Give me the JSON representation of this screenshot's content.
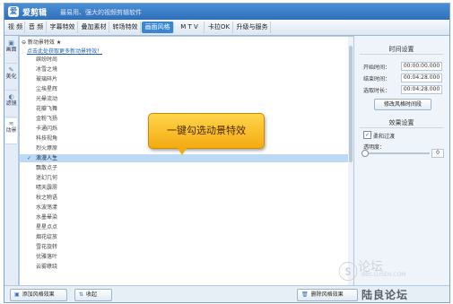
{
  "app": {
    "name": "爱剪辑",
    "slogan": "最易用、强大的视频剪辑软件",
    "logo_glyph": "爱"
  },
  "tabs": [
    {
      "label": "视 频",
      "active": false
    },
    {
      "label": "音 频",
      "active": false
    },
    {
      "label": "字幕特效",
      "active": false
    },
    {
      "label": "叠加素材",
      "active": false
    },
    {
      "label": "转场特效",
      "active": false
    },
    {
      "label": "画面风格",
      "active": true
    },
    {
      "label": "M T V",
      "active": false
    },
    {
      "label": "卡拉OK",
      "active": false
    },
    {
      "label": "升级与服务",
      "active": false
    }
  ],
  "side_tabs": [
    {
      "label": "画面",
      "icon": "▣"
    },
    {
      "label": "美化",
      "icon": "✎"
    },
    {
      "label": "滤镜",
      "icon": "◐"
    },
    {
      "label": "动景",
      "icon": "≋"
    }
  ],
  "list": {
    "header": "⊖ 新动景特效 ★",
    "link": "点击此处获取更多新动景特效！",
    "items": [
      "缤纷时尚",
      "冰雪之境",
      "玻璃碎片",
      "尘埃星辉",
      "光晕流动",
      "花瓣飞舞",
      "金粉飞扬",
      "卡通闪烁",
      "科技视角",
      "烈火燎原",
      "浪漫人生",
      "飘散点子",
      "迷幻几何",
      "晴天霹雳",
      "秋之物语",
      "水波荡漾",
      "水墨晕染",
      "星星点点",
      "烟花绽放",
      "雪花旋转",
      "优雅落叶",
      "云雾缭绕"
    ],
    "selected_index": 10
  },
  "callout": "一键勾选动景特效",
  "right_panel": {
    "time_title": "时间设置",
    "start_label": "开始时间：",
    "start_value": "00:00:00.000",
    "end_label": "结束时间：",
    "end_value": "00:04:28.000",
    "duration_label": "选取时长：",
    "duration_value": "00:04:28.000",
    "modify_button": "修改风格时间段",
    "effect_title": "效果设置",
    "soft_transition_label": "柔和过渡",
    "soft_transition_checked": true,
    "opacity_label": "透明度：",
    "opacity_value": "0"
  },
  "bottom": {
    "add_button": "添加风格效果",
    "fold_button": "收起",
    "delete_button": "删除风格效果"
  },
  "watermark": {
    "logo": "ⓢ",
    "brand": "论坛",
    "url": "BBS.LUSEN.COM",
    "bottom_text": "陆良论坛"
  }
}
